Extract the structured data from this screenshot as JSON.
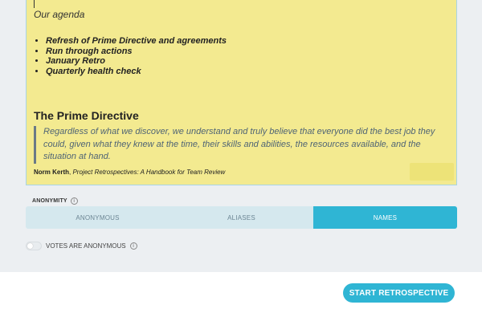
{
  "note": {
    "agenda_title": "Our agenda",
    "agenda_items": [
      "Refresh of Prime Directive and agreements",
      "Run through actions",
      "January Retro",
      "Quarterly health check"
    ],
    "pd_heading": "The Prime Directive",
    "quote": "Regardless of what we discover, we understand and truly believe that everyone did the best job they could, given what they knew at the time, their skills and abilities, the resources available, and the situation at hand.",
    "author": "Norm Kerth",
    "source": "Project Retrospectives: A Handbook for Team Review"
  },
  "anonymity": {
    "label": "ANONYMITY",
    "info_icon": "info-icon",
    "options": [
      "ANONYMOUS",
      "ALIASES",
      "NAMES"
    ],
    "selected": "NAMES"
  },
  "votes": {
    "label": "VOTES ARE ANONYMOUS",
    "enabled": false
  },
  "footer": {
    "start_label": "START RETROSPECTIVE"
  },
  "colors": {
    "accent": "#2fb5d4",
    "note_bg": "#f3ea90"
  }
}
